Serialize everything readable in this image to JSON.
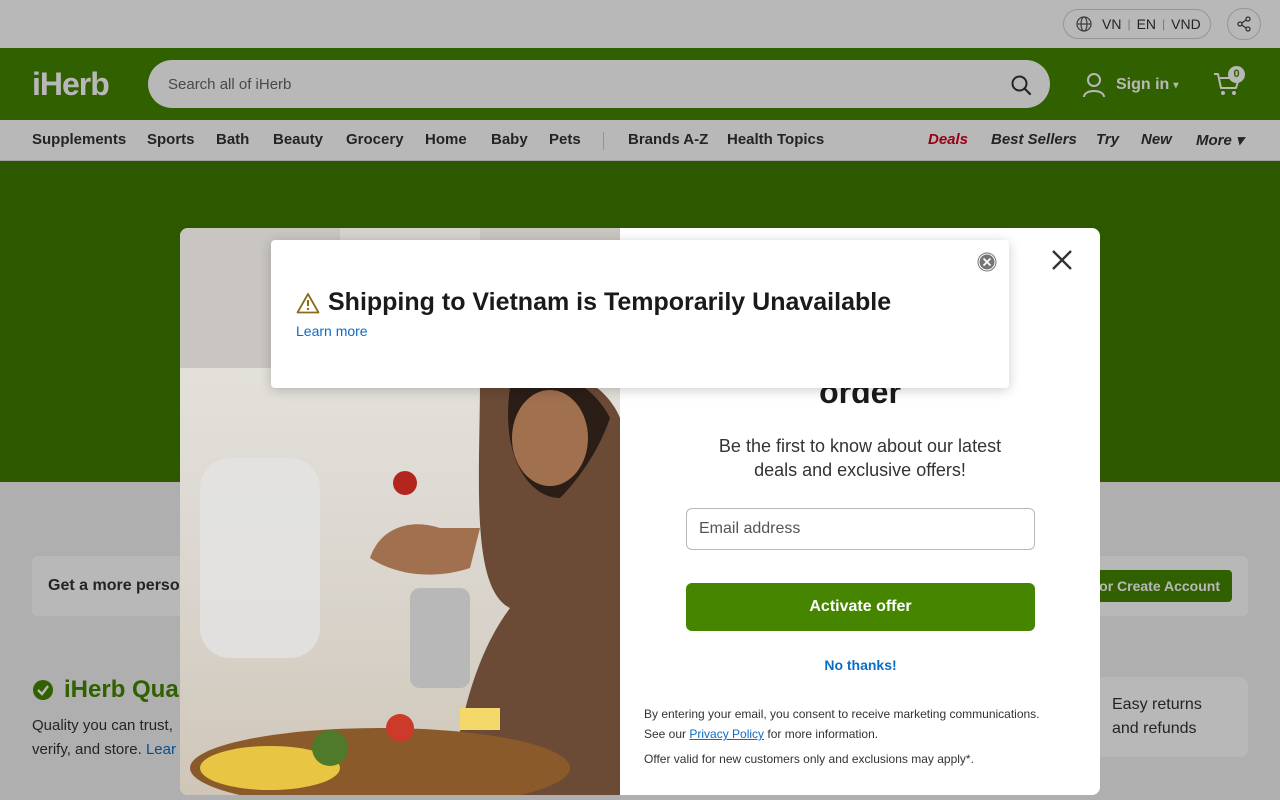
{
  "topbar": {
    "country": "VN",
    "language": "EN",
    "currency": "VND",
    "globe_icon": "globe-icon",
    "share_icon": "share-icon"
  },
  "header": {
    "logo": "iHerb",
    "search_placeholder": "Search all of iHerb",
    "signin_label": "Sign in",
    "cart_count": "0",
    "brand_color": "#458500"
  },
  "nav": {
    "left": [
      "Supplements",
      "Sports",
      "Bath",
      "Beauty",
      "Grocery",
      "Home",
      "Baby",
      "Pets"
    ],
    "middle": [
      "Brands A-Z",
      "Health Topics"
    ],
    "right": [
      "Deals",
      "Best Sellers",
      "Try",
      "New",
      "More"
    ],
    "deals_color": "#d0021b"
  },
  "page": {
    "personal_text": "Get a more person",
    "signin_account": "n or Create Account",
    "quality_title": "iHerb Qual",
    "quality_text": "Quality you can trust,",
    "quality_text2": "verify, and store.",
    "quality_link": "Lear",
    "returns": "Easy returns and refunds"
  },
  "offer_modal": {
    "heading_tail": "order",
    "subtitle": "Be the first to know about our latest deals and exclusive offers!",
    "email_placeholder": "Email address",
    "activate_label": "Activate offer",
    "no_thanks": "No thanks!",
    "consent_pre": "By entering your email, you consent to receive marketing communications. See our ",
    "privacy_link": "Privacy Policy",
    "consent_post": " for more information.",
    "offer_valid": "Offer valid for new customers only and exclusions may apply*."
  },
  "ship_modal": {
    "title": "Shipping to Vietnam is Temporarily Unavailable",
    "learn_more": "Learn more",
    "warning_icon": "warning-icon"
  }
}
